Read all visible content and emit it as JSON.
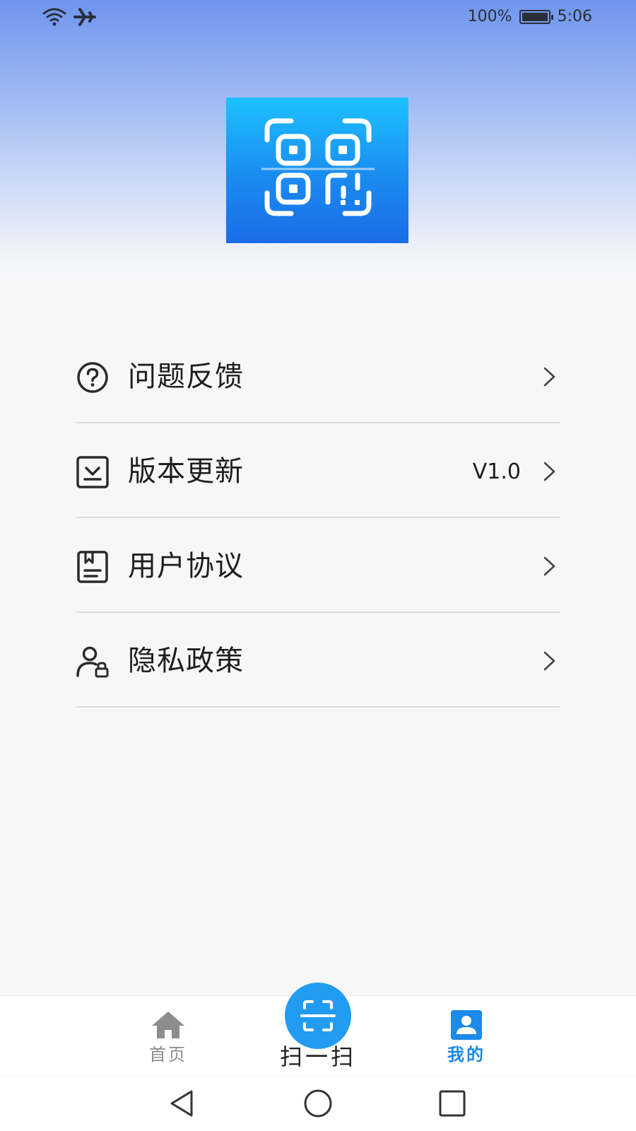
{
  "status_bar": {
    "battery": "100%",
    "time": "5:06",
    "icons": [
      "wifi-icon",
      "airplane-mode-icon",
      "battery-charging-icon"
    ]
  },
  "app": {
    "logo_icon": "qr-code-scan-logo"
  },
  "menu": {
    "items": [
      {
        "label": "问题反馈",
        "icon": "help-circle-icon",
        "value": ""
      },
      {
        "label": "版本更新",
        "icon": "download-box-icon",
        "value": "V1.0"
      },
      {
        "label": "用户协议",
        "icon": "document-icon",
        "value": ""
      },
      {
        "label": "隐私政策",
        "icon": "user-lock-icon",
        "value": ""
      }
    ]
  },
  "bottom_nav": {
    "home_label": "首页",
    "scan_label": "扫一扫",
    "mine_label": "我的",
    "active": "我的",
    "colors": {
      "accent": "#1b8ae8",
      "inactive": "#8c8c8c",
      "scan_button": "#229cf2"
    }
  },
  "system_nav": {
    "buttons": [
      "back-icon",
      "home-circle-icon",
      "recent-apps-icon"
    ]
  }
}
